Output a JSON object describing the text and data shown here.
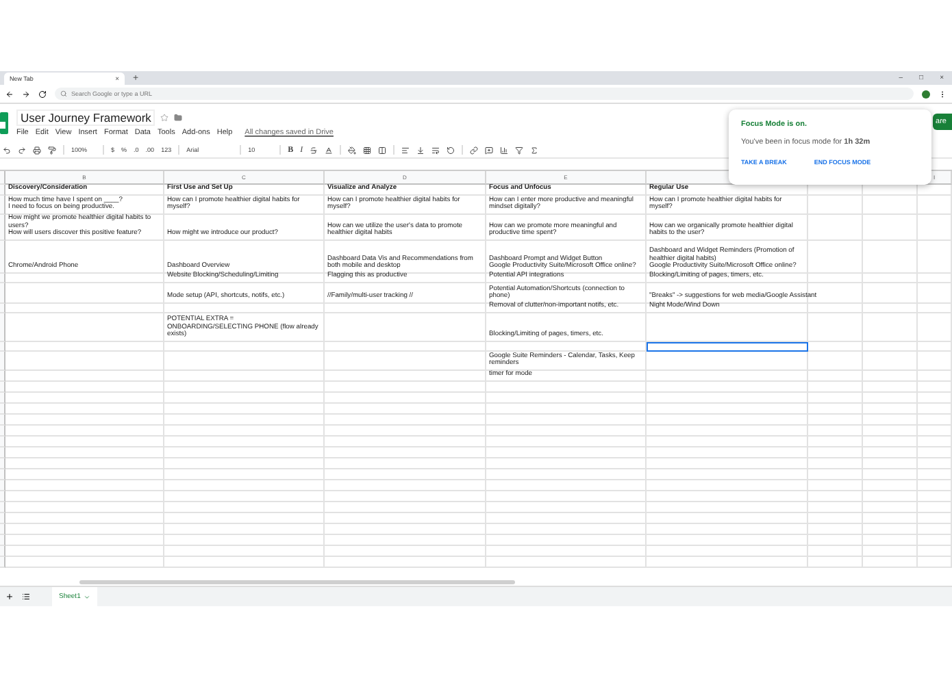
{
  "browser": {
    "tabs": [
      {
        "title": "New Tab",
        "close": "×",
        "selected": true
      }
    ],
    "new_tab": "+",
    "window_controls": [
      "–",
      "□",
      "×"
    ],
    "address_placeholder": "Search Google or type a URL"
  },
  "doc": {
    "title": "User Journey Framework",
    "menu": [
      "File",
      "Edit",
      "View",
      "Insert",
      "Format",
      "Data",
      "Tools",
      "Add-ons",
      "Help"
    ],
    "save_status": "All changes saved in Drive",
    "share_label": "are"
  },
  "toolbar": {
    "zoom": "100%",
    "currency": "$",
    "percent": "%",
    "dec_less": ".0",
    "dec_more": ".00",
    "number_format": "123",
    "font": "Arial",
    "font_size": "10",
    "bold": "B",
    "italic": "I"
  },
  "focus_popup": {
    "title": "Focus Mode is on.",
    "message": "You've been in focus mode for **1h 32m**",
    "actions": [
      "TAKE A BREAK",
      "END FOCUS MODE"
    ]
  },
  "sheet": {
    "columns": [
      {
        "label": "B"
      },
      {
        "label": "C"
      },
      {
        "label": "D"
      },
      {
        "label": "E"
      },
      {},
      {},
      {},
      {
        "label": "I"
      }
    ],
    "rows": [
      {
        "header": true,
        "cells": [
          {
            "text": "Discovery/Consideration",
            "selected": false
          },
          {
            "text": "First Use and Set Up",
            "selected": false
          },
          {
            "text": "Visualize and Analyze",
            "selected": false
          },
          {
            "text": "Focus and Unfocus",
            "selected": false
          },
          {
            "text": "Regular Use",
            "selected": false
          }
        ]
      },
      {
        "header": false,
        "cells": [
          {
            "text": "How much time have I spent on ____?\nI need to focus on being productive.",
            "selected": false
          },
          {
            "text": "How can I promote healthier digital habits for myself?",
            "selected": false
          },
          {
            "text": "How can I promote healthier digital habits for myself?",
            "selected": false
          },
          {
            "text": "How can I enter more productive and meaningful mindset digitally?",
            "selected": false
          },
          {
            "text": "How can I promote healthier digital habits for myself?",
            "selected": false
          }
        ]
      },
      {
        "header": false,
        "cells": [
          {
            "text": "How might we promote healthier digital habits to users?\nHow will users discover this positive feature?",
            "selected": false
          },
          {
            "text": "How might we introduce our product?",
            "selected": false
          },
          {
            "text": "How can we utilize the user's data to promote healthier digital habits",
            "selected": false
          },
          {
            "text": "How can we promote more meaningful and productive time spent?",
            "selected": false
          },
          {
            "text": "How can we organically promote healthier digital habits to the user?",
            "selected": false
          }
        ]
      },
      {
        "header": false,
        "cells": [
          {
            "text": "Chrome/Android Phone",
            "selected": false
          },
          {
            "text": "Dashboard Overview",
            "selected": false
          },
          {
            "text": "Dashboard Data Vis and Recommendations from both mobile and desktop",
            "selected": false
          },
          {
            "text": "Dashboard Prompt and Widget Button\nGoogle Productivity Suite/Microsoft Office online?",
            "selected": false
          },
          {
            "text": "Dashboard and Widget Reminders (Promotion of healthier digital habits)\nGoogle Productivity Suite/Microsoft Office online?",
            "selected": false
          }
        ]
      },
      {
        "header": false,
        "cells": [
          {
            "selected": false
          },
          {
            "text": "Website Blocking/Scheduling/Limiting",
            "selected": false
          },
          {
            "text": "Flagging this as productive",
            "selected": false
          },
          {
            "text": "Potential API integrations",
            "selected": false
          },
          {
            "text": "Blocking/Limiting of pages, timers, etc.",
            "selected": false
          }
        ]
      },
      {
        "header": false,
        "cells": [
          {
            "selected": false
          },
          {
            "text": "Mode setup (API, shortcuts, notifs, etc.)",
            "selected": false
          },
          {
            "text": "//Family/multi-user tracking //",
            "selected": false
          },
          {
            "text": "Potential Automation/Shortcuts (connection to phone)",
            "selected": false
          },
          {
            "text": "\"Breaks\" -> suggestions for web media/Google Assistant",
            "selected": false
          }
        ]
      },
      {
        "header": false,
        "cells": [
          {
            "selected": false
          },
          {
            "selected": false
          },
          {
            "selected": false
          },
          {
            "text": "Removal of clutter/non-important notifs, etc.",
            "selected": false
          },
          {
            "text": "Night Mode/Wind Down",
            "selected": false
          }
        ]
      },
      {
        "header": false,
        "cells": [
          {
            "selected": false
          },
          {
            "text": "POTENTIAL EXTRA = ONBOARDING/SELECTING PHONE (flow already exists)",
            "selected": false
          },
          {
            "selected": false
          },
          {
            "text": "Blocking/Limiting of pages, timers, etc.",
            "selected": false
          },
          {
            "selected": false
          }
        ]
      },
      {
        "header": false,
        "cells": [
          {
            "selected": false
          },
          {
            "selected": false
          },
          {
            "selected": false
          },
          {
            "selected": false
          },
          {
            "selected": true
          }
        ]
      },
      {
        "header": false,
        "cells": [
          {
            "selected": false
          },
          {
            "selected": false
          },
          {
            "selected": false
          },
          {
            "text": "Google Suite Reminders - Calendar, Tasks, Keep reminders",
            "selected": false
          },
          {
            "selected": false
          }
        ]
      },
      {
        "header": false,
        "cells": [
          {
            "selected": false
          },
          {
            "selected": false
          },
          {
            "selected": false
          },
          {
            "text": "timer for mode",
            "selected": false
          },
          {
            "selected": false
          }
        ]
      }
    ],
    "sheet_tabs": [
      {
        "label": "Sheet1",
        "selected": true
      }
    ]
  }
}
